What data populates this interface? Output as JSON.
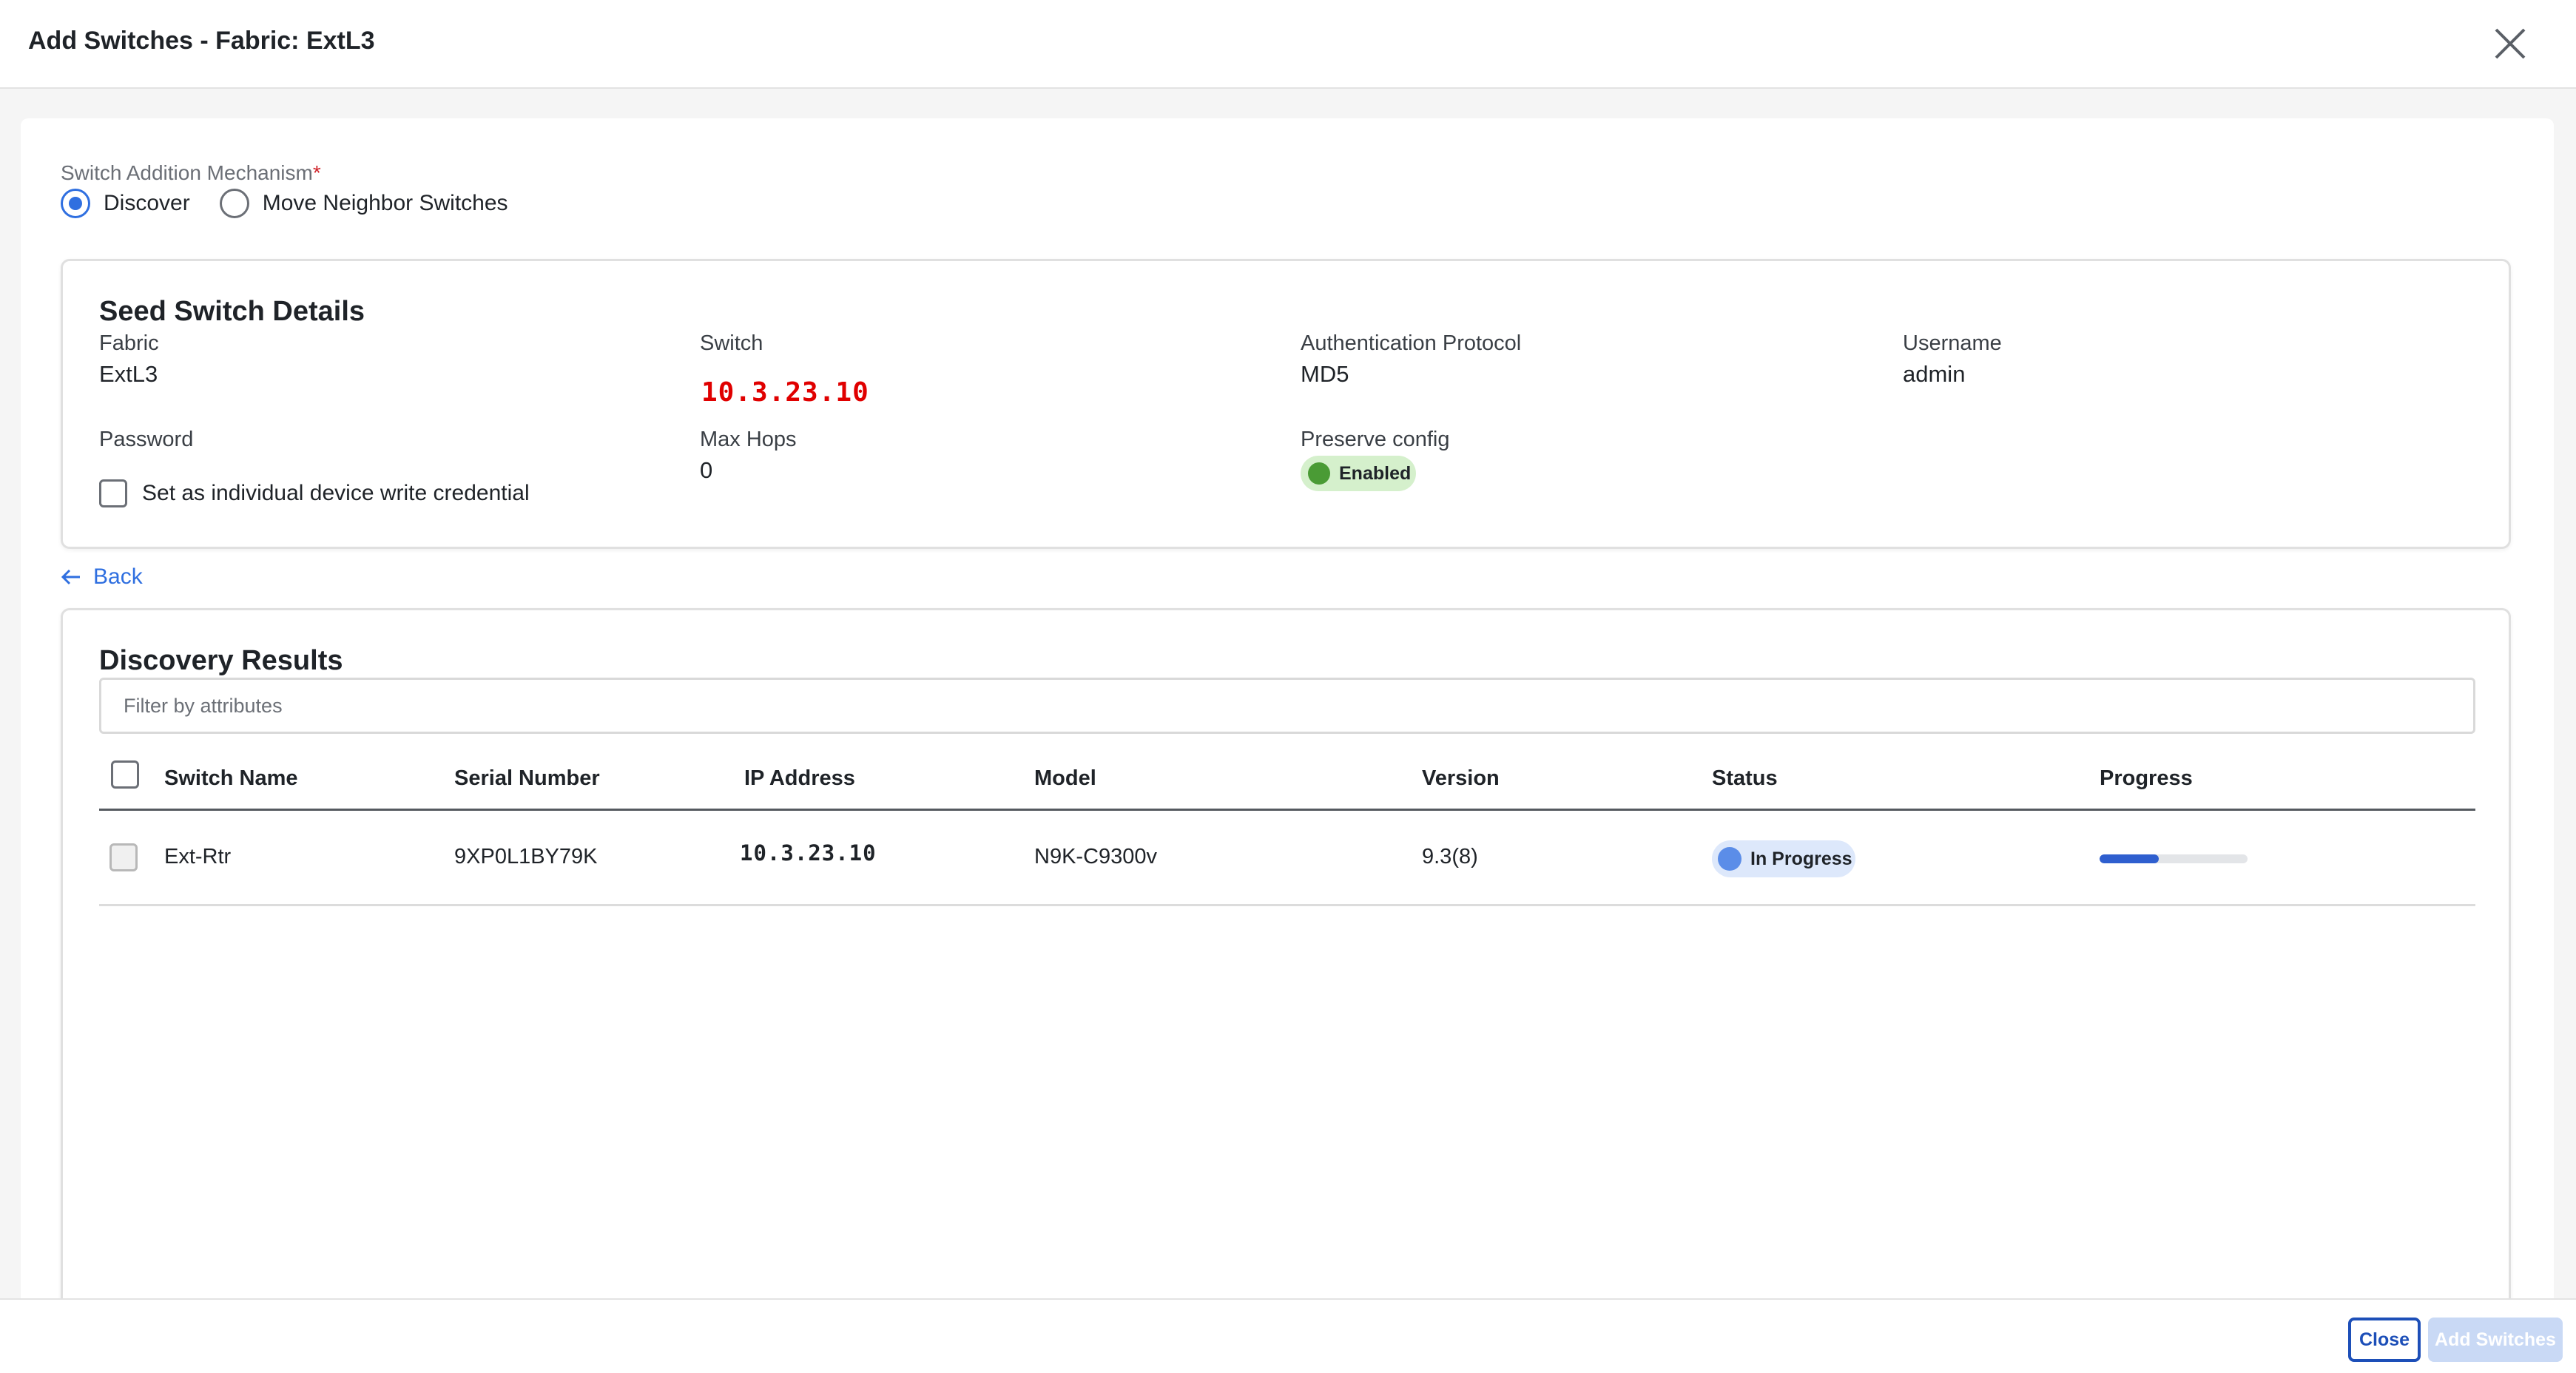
{
  "header": {
    "title": "Add Switches - Fabric: ExtL3"
  },
  "mechanism": {
    "label": "Switch Addition Mechanism",
    "required_mark": "*",
    "options": [
      {
        "label": "Discover",
        "selected": true
      },
      {
        "label": "Move Neighbor Switches",
        "selected": false
      }
    ]
  },
  "seed": {
    "title": "Seed Switch Details",
    "fabric_label": "Fabric",
    "fabric_value": "ExtL3",
    "switch_label": "Switch",
    "switch_value": "10.3.23.10",
    "auth_label": "Authentication Protocol",
    "auth_value": "MD5",
    "username_label": "Username",
    "username_value": "admin",
    "password_label": "Password",
    "credential_checkbox_label": "Set as individual device write credential",
    "maxhops_label": "Max Hops",
    "maxhops_value": "0",
    "preserve_label": "Preserve config",
    "preserve_badge": "Enabled"
  },
  "back_label": "Back",
  "results": {
    "title": "Discovery Results",
    "filter_placeholder": "Filter by attributes",
    "columns": [
      "Switch Name",
      "Serial Number",
      "IP Address",
      "Model",
      "Version",
      "Status",
      "Progress"
    ],
    "rows": [
      {
        "switch_name": "Ext-Rtr",
        "serial": "9XP0L1BY79K",
        "ip": "10.3.23.10",
        "model": "N9K-C9300v",
        "version": "9.3(8)",
        "status": "In Progress",
        "progress_fraction": 0.4
      }
    ]
  },
  "footer": {
    "close_label": "Close",
    "add_label": "Add Switches"
  },
  "colors": {
    "accent": "#2f6fe0",
    "ip_red": "#e00000",
    "enabled_badge_bg": "#d5f0cc",
    "in_progress_badge_bg": "#dde8fb"
  }
}
